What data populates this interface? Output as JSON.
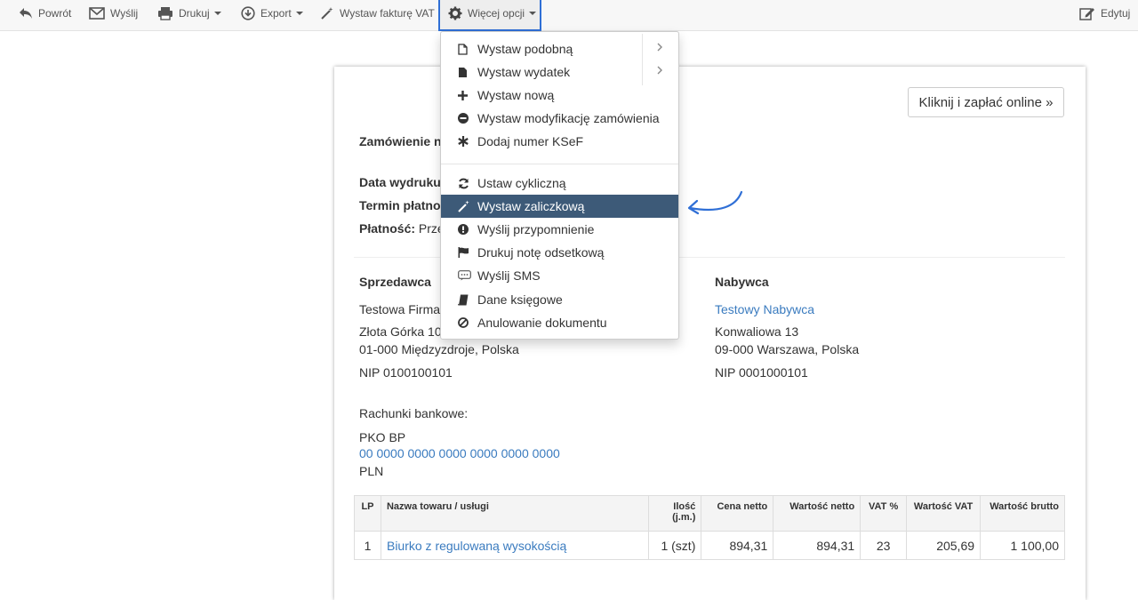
{
  "toolbar": {
    "back": "Powrót",
    "send": "Wyślij",
    "print": "Drukuj",
    "export": "Export",
    "vat_invoice": "Wystaw fakturę VAT",
    "more": "Więcej opcji",
    "edit": "Edytuj"
  },
  "dropdown": {
    "items": [
      {
        "label": "Wystaw podobną",
        "icon": "file-outline-icon",
        "submenu": true
      },
      {
        "label": "Wystaw wydatek",
        "icon": "file-icon",
        "submenu": true
      },
      {
        "label": "Wystaw nową",
        "icon": "plus-icon"
      },
      {
        "label": "Wystaw modyfikację zamówienia",
        "icon": "minus-circle-icon"
      },
      {
        "label": "Dodaj numer KSeF",
        "icon": "asterisk-icon"
      },
      {
        "label": "Ustaw cykliczną",
        "icon": "refresh-icon"
      },
      {
        "label": "Wystaw zaliczkową",
        "icon": "magic-wand-icon",
        "active": true
      },
      {
        "label": "Wyślij przypomnienie",
        "icon": "exclamation-circle-icon"
      },
      {
        "label": "Drukuj notę odsetkową",
        "icon": "flag-icon"
      },
      {
        "label": "Wyślij SMS",
        "icon": "sms-icon"
      },
      {
        "label": "Dane księgowe",
        "icon": "book-icon"
      },
      {
        "label": "Anulowanie dokumentu",
        "icon": "ban-icon"
      }
    ]
  },
  "invoice": {
    "pay_online": "Kliknij i zapłać online »",
    "order_label": "Zamówienie n",
    "print_date_label": "Data wydruku",
    "due_label": "Termin płatno",
    "payment_label": "Płatność:",
    "payment_value": "Prze",
    "seller": {
      "heading": "Sprzedawca",
      "name": "Testowa Firma",
      "street": "Złota Górka 10",
      "city": "01-000 Międzyzdroje, Polska",
      "nip": "NIP 0100100101"
    },
    "buyer": {
      "heading": "Nabywca",
      "name": "Testowy Nabywca",
      "street": "Konwaliowa 13",
      "city": "09-000 Warszawa, Polska",
      "nip": "NIP 0001000101"
    },
    "bank": {
      "label": "Rachunki bankowe:",
      "name": "PKO BP",
      "account": "00 0000 0000 0000 0000 0000 0000",
      "currency": "PLN"
    },
    "table": {
      "headers": [
        "LP",
        "Nazwa towaru / usługi",
        "Ilość (j.m.)",
        "Cena netto",
        "Wartość netto",
        "VAT %",
        "Wartość VAT",
        "Wartość brutto"
      ],
      "rows": [
        [
          "1",
          "Biurko z regulowaną wysokością",
          "1 (szt)",
          "894,31",
          "894,31",
          "23",
          "205,69",
          "1 100,00"
        ]
      ]
    }
  },
  "colors": {
    "accent": "#2f6fd6",
    "active_item": "#3d5a78",
    "link": "#3a7bbf"
  }
}
